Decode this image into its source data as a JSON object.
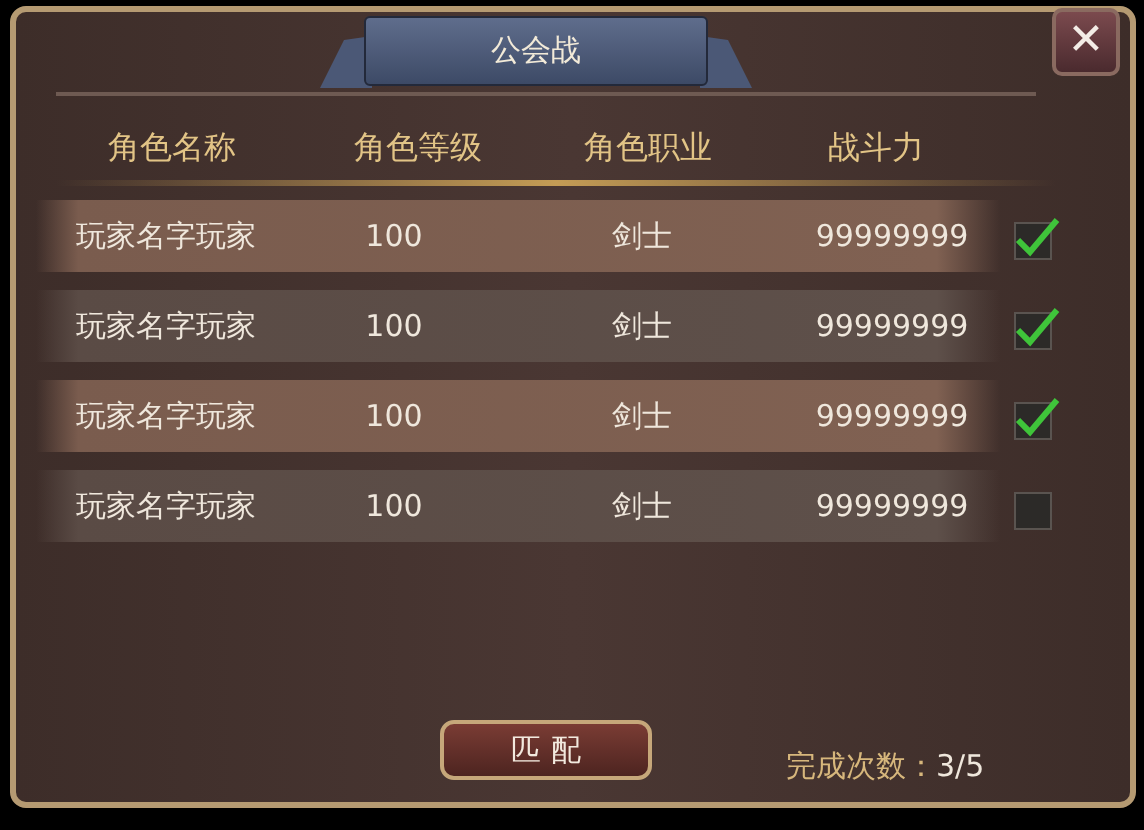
{
  "title": "公会战",
  "close": "✕",
  "columns": [
    "角色名称",
    "角色等级",
    "角色职业",
    "战斗力"
  ],
  "rows": [
    {
      "name": "玩家名字玩家",
      "level_text": "100",
      "job": "剑士",
      "power": "99999999",
      "checked": true
    },
    {
      "name": "玩家名字玩家",
      "level_text": "100",
      "job": "剑士",
      "power": "99999999",
      "checked": true
    },
    {
      "name": "玩家名字玩家",
      "level_text": "100",
      "job": "剑士",
      "power": "99999999",
      "checked": true
    },
    {
      "name": "玩家名字玩家",
      "level_text": "100",
      "job": "剑士",
      "power": "99999999",
      "checked": false
    }
  ],
  "match_button": "匹 配",
  "completion": {
    "label": "完成次数：",
    "value": "3/5"
  }
}
